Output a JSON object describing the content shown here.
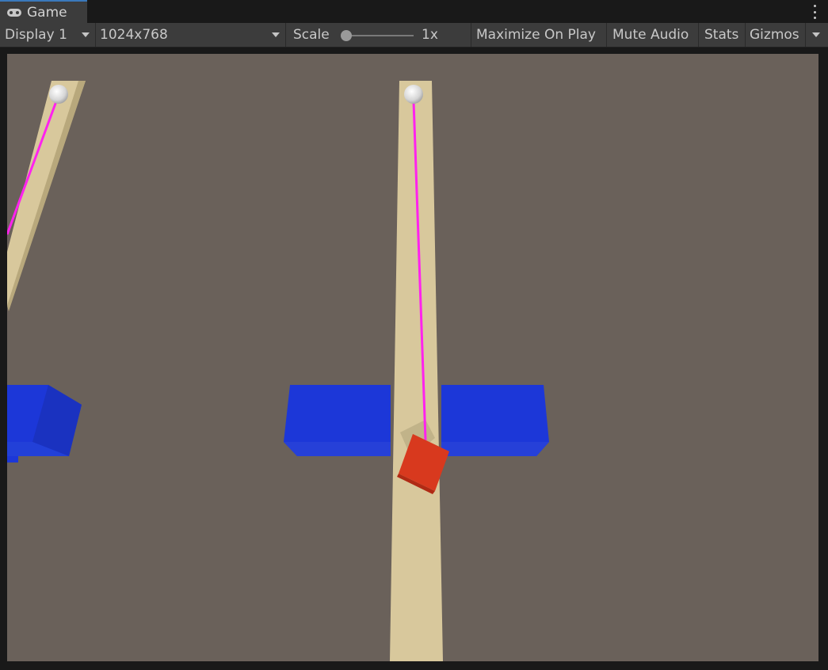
{
  "tab": {
    "label": "Game",
    "icon": "gamepad-icon"
  },
  "toolbar": {
    "display": "Display 1",
    "resolution": "1024x768",
    "scale_label": "Scale",
    "scale_value": "1x",
    "scale_level": 0.0,
    "maximize": "Maximize On Play",
    "mute": "Mute Audio",
    "stats": "Stats",
    "gizmos": "Gizmos"
  },
  "colors": {
    "ground": "#6a615a",
    "track": "#d8c89c",
    "blue_block": "#1c37d8",
    "red_cube": "#d8391e",
    "line": "#ff22ee",
    "ball": "#e8e8e8",
    "accent": "#3a79bb"
  }
}
